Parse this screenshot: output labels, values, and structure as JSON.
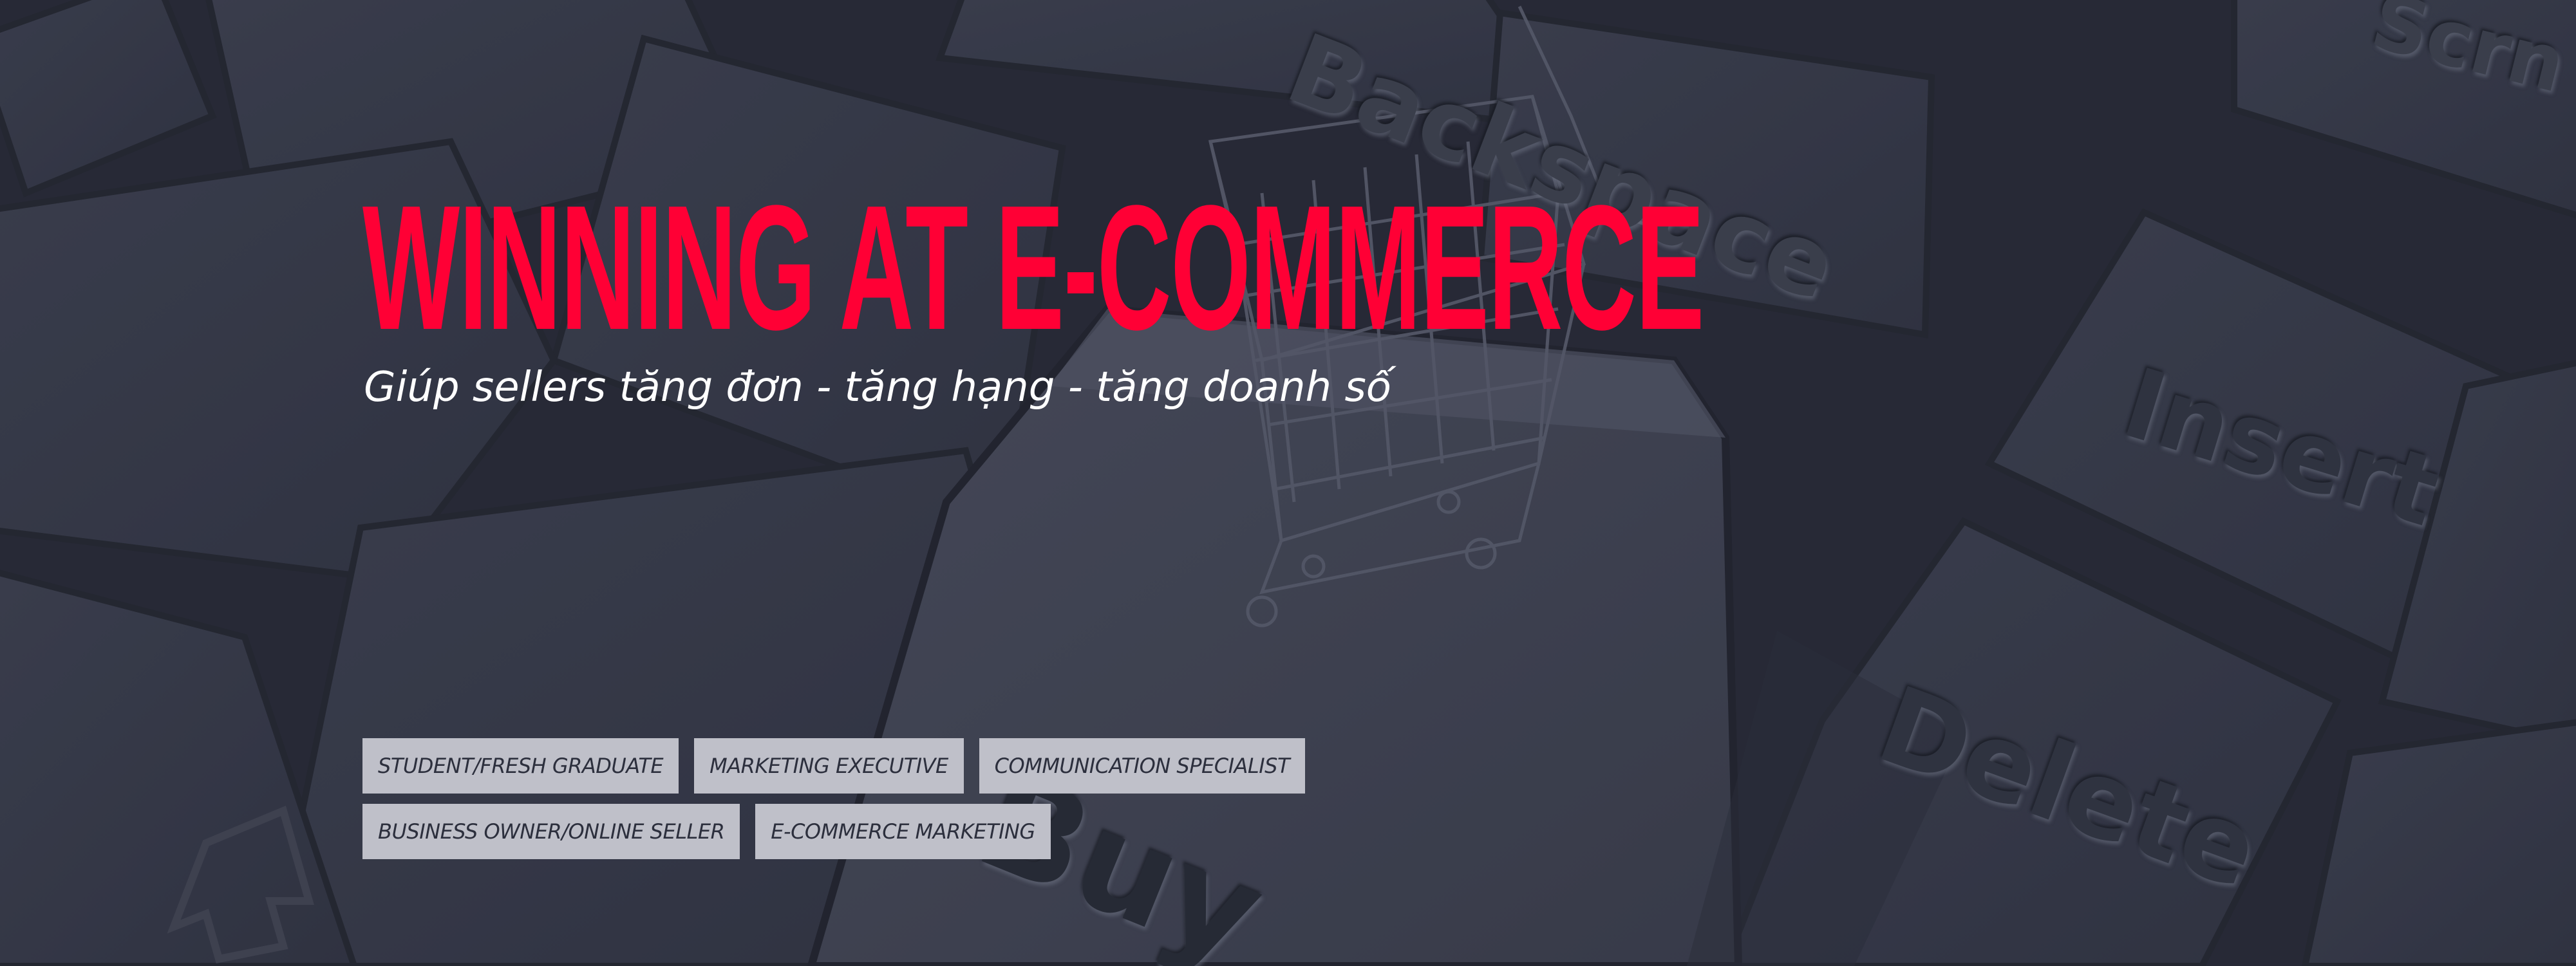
{
  "hero": {
    "title": "WINNING AT E-COMMERCE",
    "subtitle": "Giúp sellers tăng đơn - tăng hạng - tăng doanh số"
  },
  "background": {
    "key_labels": {
      "backspace": "Backspace",
      "insert": "Insert",
      "delete": "Delete",
      "buy": "Buy",
      "print_screen": "Scrn SysRq"
    }
  },
  "tags": {
    "row1": [
      "STUDENT/FRESH GRADUATE",
      "MARKETING EXECUTIVE",
      "COMMUNICATION SPECIALIST"
    ],
    "row2": [
      "BUSINESS OWNER/ONLINE SELLER",
      "E-COMMERCE MARKETING"
    ]
  },
  "colors": {
    "title": "#ff0035",
    "subtitle": "#ffffff",
    "tag_background": "#bfc0c9",
    "tag_text": "#2c2f3d",
    "overlay": "#2c2f3b"
  },
  "icons": {
    "shopping_cart": "shopping-cart-icon",
    "arrow_key": "arrow-up-key-icon"
  }
}
